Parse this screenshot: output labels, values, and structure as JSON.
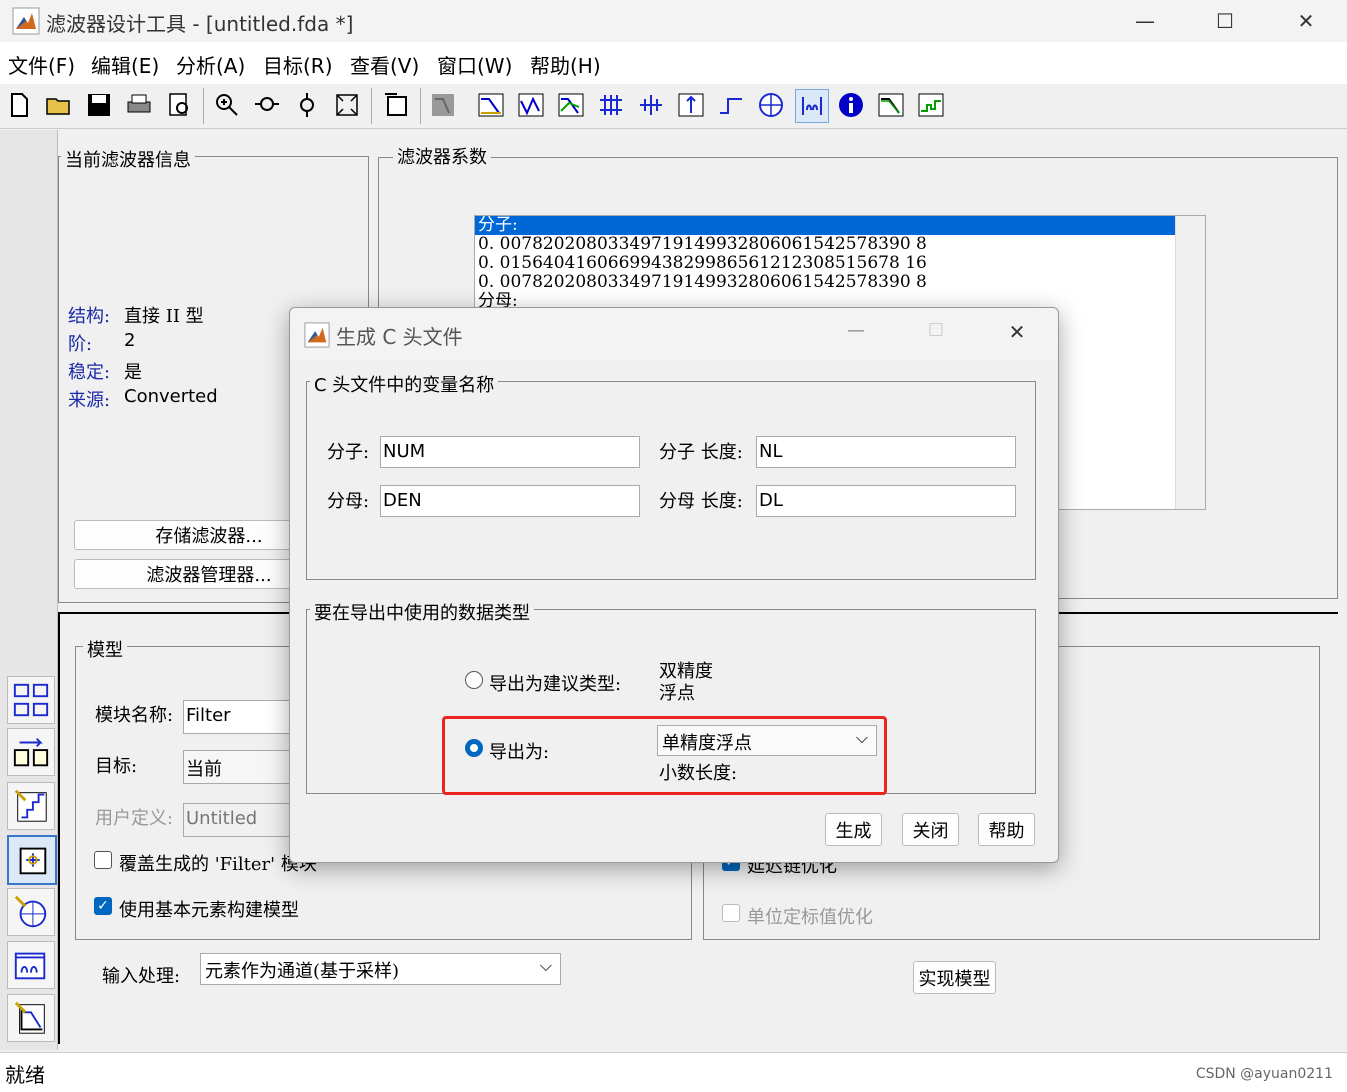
{
  "window": {
    "title": "滤波器设计工具 -  [untitled.fda *]",
    "minimize_glyph": "—",
    "maximize_glyph": "☐",
    "close_glyph": "✕"
  },
  "menu": [
    "文件(F)",
    "编辑(E)",
    "分析(A)",
    "目标(R)",
    "查看(V)",
    "窗口(W)",
    "帮助(H)"
  ],
  "toolbar_icons": [
    "new-file-icon",
    "open-folder-icon",
    "save-icon",
    "print-icon",
    "print-preview-icon",
    "zoom-in-icon",
    "zoom-x-icon",
    "zoom-y-icon",
    "full-view-icon",
    "new-window-icon",
    "filter-image-icon",
    "magnitude-response-icon",
    "phase-response-icon",
    "magnitude-phase-icon",
    "group-delay-icon",
    "phase-delay-icon",
    "impulse-response-icon",
    "step-response-icon",
    "pole-zero-icon",
    "coefficients-icon",
    "info-icon",
    "magnitude-estimate-icon",
    "round-off-noise-icon"
  ],
  "filter_info": {
    "legend": "当前滤波器信息",
    "rows": [
      {
        "key": "结构:",
        "value": "直接 II 型"
      },
      {
        "key": "阶:",
        "value": "2"
      },
      {
        "key": "稳定:",
        "value": "是"
      },
      {
        "key": "来源:",
        "value": "Converted"
      }
    ],
    "store_button": "存储滤波器...",
    "manager_button": "滤波器管理器..."
  },
  "coefficients": {
    "legend": "滤波器系数",
    "lines": [
      "分子:",
      "0. 00782020803349719149932806061542578390 8",
      "0. 0156404160669943829986561212308515678 16",
      "0. 00782020803349719149932806061542578390 8",
      "分母:"
    ]
  },
  "model": {
    "legend": "模型",
    "block_name_label": "模块名称:",
    "block_name_value": "Filter",
    "target_label": "目标:",
    "target_value": "当前",
    "user_defined_label": "用户定义:",
    "user_defined_value": "Untitled",
    "overwrite_label": "覆盖生成的 'Filter' 模块",
    "basic_elements_label": "使用基本元素构建模型",
    "delay_chain_label": "延迟链优化",
    "unit_scale_label": "单位定标值优化",
    "input_processing_label": "输入处理:",
    "input_processing_value": "元素作为通道(基于采样)",
    "realize_button": "实现模型"
  },
  "status": {
    "text": "就绪",
    "watermark": "CSDN @ayuan0211"
  },
  "dialog": {
    "title": "生成 C 头文件",
    "var_group_legend": "C 头文件中的变量名称",
    "num_label": "分子:",
    "num_value": "NUM",
    "num_len_label": "分子 长度:",
    "num_len_value": "NL",
    "den_label": "分母:",
    "den_value": "DEN",
    "den_len_label": "分母 长度:",
    "den_len_value": "DL",
    "type_group_legend": "要在导出中使用的数据类型",
    "suggested_label": "导出为建议类型:",
    "suggested_value_line1": "双精度",
    "suggested_value_line2": "浮点",
    "export_as_label": "导出为:",
    "export_as_value": "单精度浮点",
    "fraction_length_label": "小数长度:",
    "generate_button": "生成",
    "close_button": "关闭",
    "help_button": "帮助",
    "highlight_color": "#e8261f"
  }
}
